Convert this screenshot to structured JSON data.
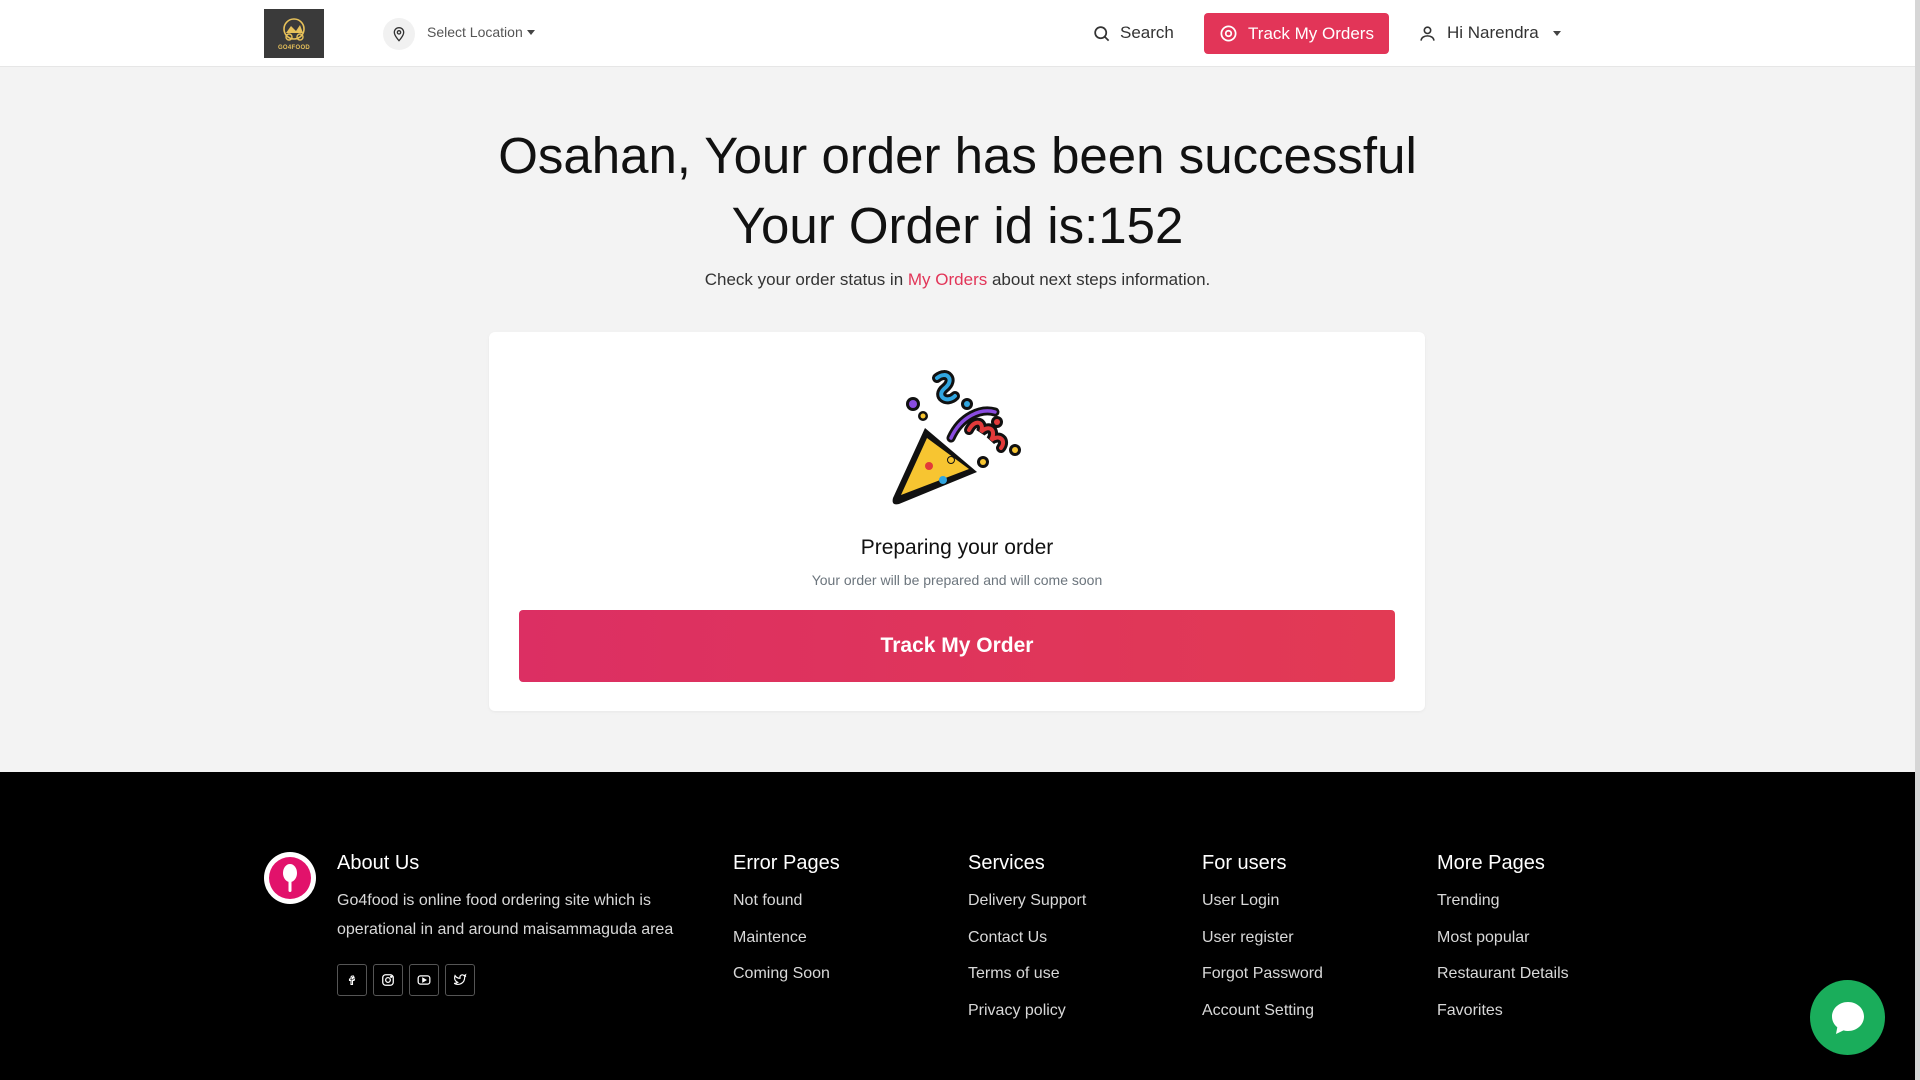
{
  "header": {
    "logo_text": "GO4FOOD",
    "location_label": "Select Location",
    "search_label": "Search",
    "track_orders_label": "Track My Orders",
    "user_greeting": "Hi Narendra"
  },
  "main": {
    "title_line1": "Osahan, Your order has been successful",
    "title_line2": "Your Order id is:152",
    "subline_before": "Check your order status in ",
    "subline_link": "My Orders",
    "subline_after": " about next steps information.",
    "card": {
      "status_title": "Preparing your order",
      "status_sub": "Your order will be prepared and will come soon",
      "button_label": "Track My Order"
    }
  },
  "footer": {
    "about": {
      "heading": "About Us",
      "text": "Go4food is online food ordering site which is operational in and around maisammaguda area",
      "socials": [
        "facebook-icon",
        "instagram-icon",
        "youtube-icon",
        "twitter-icon"
      ]
    },
    "columns": [
      {
        "heading": "Error Pages",
        "links": [
          "Not found",
          "Maintence",
          "Coming Soon"
        ]
      },
      {
        "heading": "Services",
        "links": [
          "Delivery Support",
          "Contact Us",
          "Terms of use",
          "Privacy policy"
        ]
      },
      {
        "heading": "For users",
        "links": [
          "User Login",
          "User register",
          "Forgot Password",
          "Account Setting"
        ]
      },
      {
        "heading": "More Pages",
        "links": [
          "Trending",
          "Most popular",
          "Restaurant Details",
          "Favorites"
        ]
      }
    ]
  },
  "colors": {
    "accent": "#e23558",
    "footer_bg": "#000000",
    "chat": "#1aad5b"
  }
}
